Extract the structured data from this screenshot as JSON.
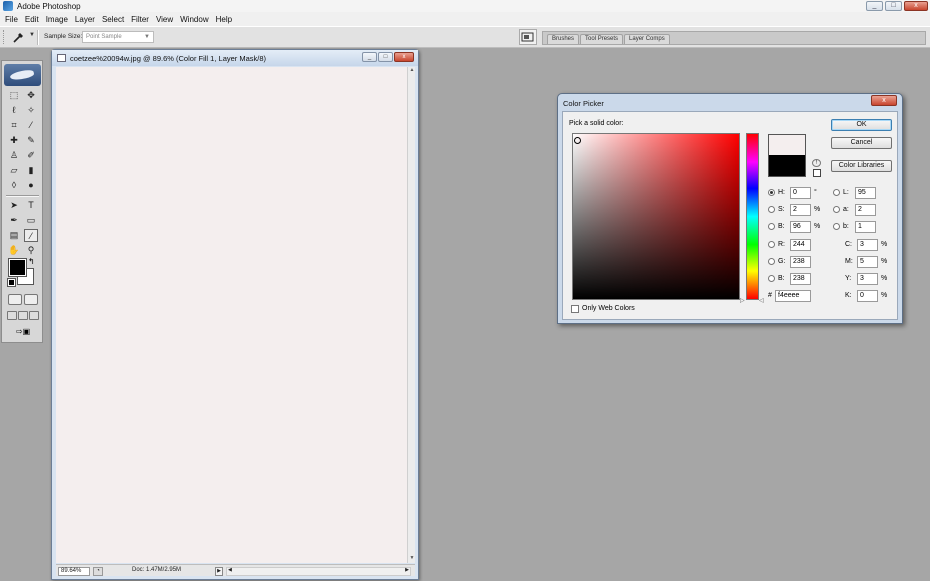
{
  "app": {
    "title": "Adobe Photoshop"
  },
  "window_controls": {
    "minimize": "_",
    "maximize": "□",
    "close": "x"
  },
  "menu": [
    "File",
    "Edit",
    "Image",
    "Layer",
    "Select",
    "Filter",
    "View",
    "Window",
    "Help"
  ],
  "options_bar": {
    "tool_icon": "eyedropper-icon",
    "sample_size_label": "Sample Size:",
    "sample_size_value": "Point Sample",
    "palette_tabs": [
      "Brushes",
      "Tool Presets",
      "Layer Comps"
    ]
  },
  "document": {
    "title": "coetzee%20094w.jpg @ 89.6% (Color Fill 1, Layer Mask/8)",
    "canvas_color": "#f4eeee",
    "zoom": "89.64%",
    "doc_size": "Doc: 1.47M/2.95M"
  },
  "color_picker": {
    "title": "Color Picker",
    "close": "x",
    "pick_label": "Pick a solid color:",
    "buttons": {
      "ok": "OK",
      "cancel": "Cancel",
      "libraries": "Color Libraries"
    },
    "hsb": [
      {
        "label": "H:",
        "value": "0",
        "unit": "°",
        "selected": true
      },
      {
        "label": "S:",
        "value": "2",
        "unit": "%",
        "selected": false
      },
      {
        "label": "B:",
        "value": "96",
        "unit": "%",
        "selected": false
      }
    ],
    "rgb": [
      {
        "label": "R:",
        "value": "244"
      },
      {
        "label": "G:",
        "value": "238"
      },
      {
        "label": "B:",
        "value": "238"
      }
    ],
    "lab": [
      {
        "label": "L:",
        "value": "95"
      },
      {
        "label": "a:",
        "value": "2"
      },
      {
        "label": "b:",
        "value": "1"
      }
    ],
    "cmyk": [
      {
        "label": "C:",
        "value": "3",
        "unit": "%"
      },
      {
        "label": "M:",
        "value": "5",
        "unit": "%"
      },
      {
        "label": "Y:",
        "value": "3",
        "unit": "%"
      },
      {
        "label": "K:",
        "value": "0",
        "unit": "%"
      }
    ],
    "hex_label": "#",
    "hex": "f4eeee",
    "new_color": "#f4eeee",
    "old_color": "#000000",
    "web_only_label": "Only Web Colors"
  }
}
